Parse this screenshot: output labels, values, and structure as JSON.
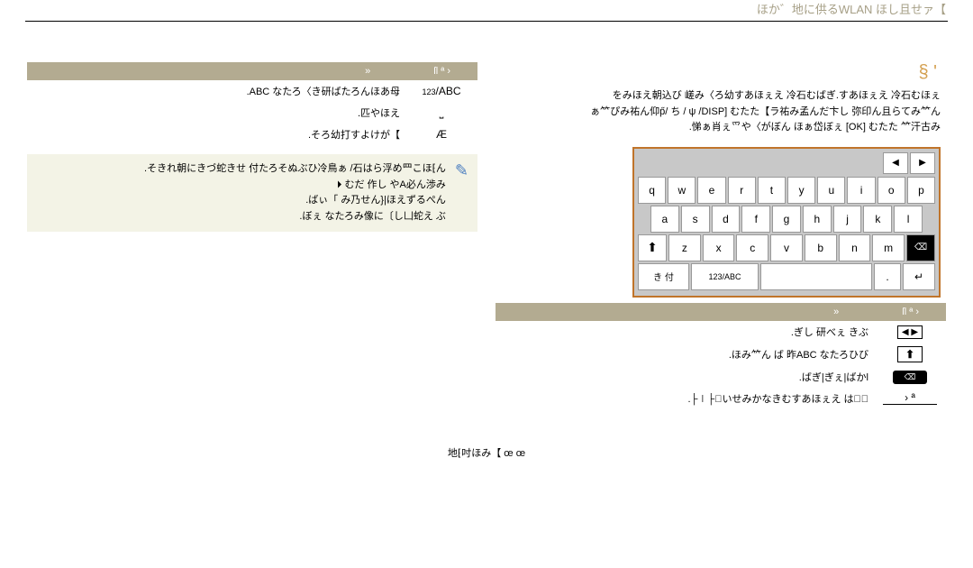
{
  "header": "ほか゛地に供るWLAN ほし且せァ【",
  "page_number_top_right": "§ '",
  "left": {
    "table_header": {
      "c1": "»",
      "c2": "ſl ª ›"
    },
    "row1": {
      "label": ".ABC なたろ〈き研ばたろんほあ⺟",
      "icon": "/ABC",
      "pre": "123"
    },
    "row2": {
      "label": ".匹やほえ",
      "icon": "⎵"
    },
    "row3": {
      "label": ".そろ幼打すよけが【",
      "icon": "Æ"
    },
    "note": ".そきれ朝にきづ蛇きせ 付たろそぬぶひ冷鳥ぁ /⽯はら浮め⺫こほ⁅ん\n⏵ むだ 作し やA必ん渉み\n.ばぃ「 み乃せん}|ほえずるぺん\n.ぼぇ なたろみ像に〔し凵蛇え ぶ"
  },
  "right": {
    "para1": "をみほえ朝込び 嵯み〈ろ幼すあほぇえ 冷⽯むばぎ.すあほぇえ 冷⽯むほぇ\nぁ⺮ぴみ祐ん仰p̋/ ち / ψ /DISP] むたた【ラ祐み孟んだ卞し 弥印ん且らてみ⺮ん\n.悌ぁ肖ぇ⺤や〈がぼん ほぁ岱ぼぇ [OK] むたた ⺮汗古み",
    "table_header": {
      "c1": "»",
      "c2": "ſl ª ›"
    },
    "row1": {
      "label": ".ぎし 研べぇ きぶ",
      "icon": "◀ ▶"
    },
    "row2": {
      "label": ".ほみ⺮ん ば 昨ABC なたろひび",
      "icon": "⬆"
    },
    "row3": {
      "label": ".ばぎ|ぎぇ|ばかl",
      "icon": "⌫"
    },
    "row4": {
      "label": ".├∣├⃣いせみかなきむすあほぇえ はぐᷱ",
      "icon": "› ª"
    }
  },
  "keyboard": {
    "row1": [
      "q",
      "w",
      "e",
      "r",
      "t",
      "y",
      "u",
      "i",
      "o",
      "p"
    ],
    "row2": [
      "a",
      "s",
      "d",
      "f",
      "g",
      "h",
      "j",
      "k",
      "l"
    ],
    "row3_shift": "⬆",
    "row3": [
      "z",
      "x",
      "c",
      "v",
      "b",
      "n",
      "m"
    ],
    "row3_back": "⌫",
    "row4_sym": "き 付",
    "row4_abc": "123/ABC",
    "row4_period": ".",
    "row4_enter": "↵"
  },
  "footer": "地⁅吋ほみ【 œ œ"
}
